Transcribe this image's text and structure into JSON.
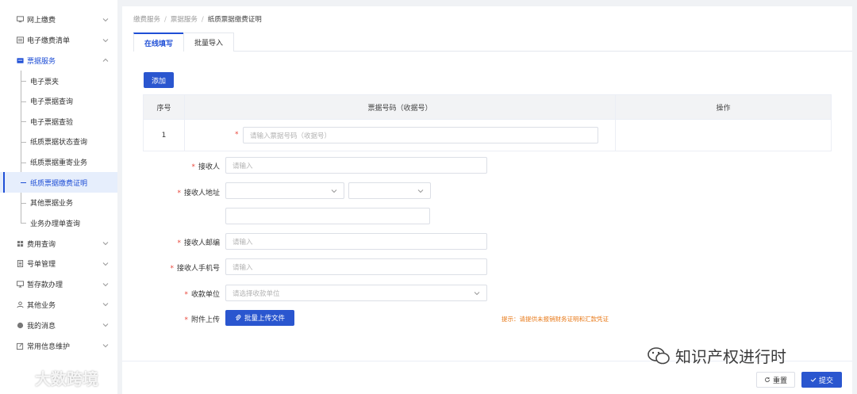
{
  "sidebar": {
    "items": [
      {
        "label": "网上缴费",
        "icon": "computer-icon"
      },
      {
        "label": "电子缴费清单",
        "icon": "list-icon"
      },
      {
        "label": "票据服务",
        "icon": "ticket-icon"
      },
      {
        "label": "费用查询",
        "icon": "grid-icon"
      },
      {
        "label": "号单管理",
        "icon": "doc-icon"
      },
      {
        "label": "暂存款办理",
        "icon": "monitor-icon"
      },
      {
        "label": "其他业务",
        "icon": "people-icon"
      },
      {
        "label": "我的消息",
        "icon": "message-icon"
      },
      {
        "label": "常用信息维护",
        "icon": "edit-icon"
      }
    ],
    "sub_items": [
      "电子票夹",
      "电子票据查询",
      "电子票据查验",
      "纸质票据状态查询",
      "纸质票据重寄业务",
      "纸质票据缴费证明",
      "其他票据业务",
      "业务办理单查询"
    ]
  },
  "breadcrumb": [
    "缴费服务",
    "票据服务",
    "纸质票据缴费证明"
  ],
  "breadcrumb_sep": "/",
  "tabs": [
    "在线填写",
    "批量导入"
  ],
  "add_button": "添加",
  "table": {
    "headers": [
      "序号",
      "票据号码（收据号）",
      "操作"
    ],
    "rows": [
      {
        "index": "1",
        "placeholder": "请输入票据号码（收据号）"
      }
    ]
  },
  "required_mark": "*",
  "form": {
    "recipient": {
      "label": "接收人",
      "placeholder": "请输入"
    },
    "address": {
      "label": "接收人地址"
    },
    "postcode": {
      "label": "接收人邮编",
      "placeholder": "请输入"
    },
    "phone": {
      "label": "接收人手机号",
      "placeholder": "请输入"
    },
    "payee": {
      "label": "收款单位",
      "placeholder": "请选择收款单位"
    },
    "attachment": {
      "label": "附件上传",
      "button": "批量上传文件"
    }
  },
  "tip": "提示：请提供未报销财务证明和汇款凭证",
  "footer": {
    "reset": "重置",
    "submit": "提交"
  },
  "watermarks": {
    "left": "大数跨境",
    "right": "知识产权进行时"
  },
  "colors": {
    "primary": "#2a56cf",
    "tip": "#e87a1a",
    "required": "#e9473b"
  }
}
